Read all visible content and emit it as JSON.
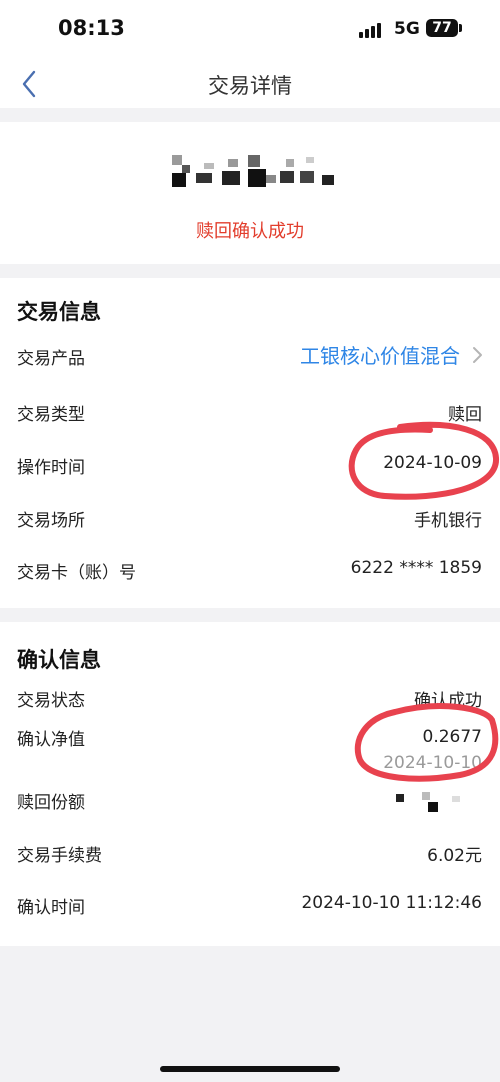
{
  "status_bar": {
    "time": "08:13",
    "network": "5G",
    "battery": "77"
  },
  "nav": {
    "title": "交易详情",
    "back_icon": "chevron-left-icon"
  },
  "result": {
    "status_text": "赎回确认成功"
  },
  "trade_info": {
    "title": "交易信息",
    "product": {
      "label": "交易产品",
      "value": "工银核心价值混合"
    },
    "type": {
      "label": "交易类型",
      "value": "赎回"
    },
    "time": {
      "label": "操作时间",
      "value": "2024-10-09"
    },
    "venue": {
      "label": "交易场所",
      "value": "手机银行"
    },
    "card": {
      "label": "交易卡（账）号",
      "value": "6222 **** 1859"
    }
  },
  "confirm_info": {
    "title": "确认信息",
    "status": {
      "label": "交易状态",
      "value": "确认成功"
    },
    "nav_value": {
      "label": "确认净值",
      "value": "0.2677",
      "date": "2024-10-10"
    },
    "shares": {
      "label": "赎回份额"
    },
    "fee": {
      "label": "交易手续费",
      "value": "6.02元"
    },
    "confirm_time": {
      "label": "确认时间",
      "value": "2024-10-10 11:12:46"
    }
  },
  "colors": {
    "accent_link": "#2f86e6",
    "status_red": "#e23d2c",
    "annotation_red": "#e8424e"
  }
}
